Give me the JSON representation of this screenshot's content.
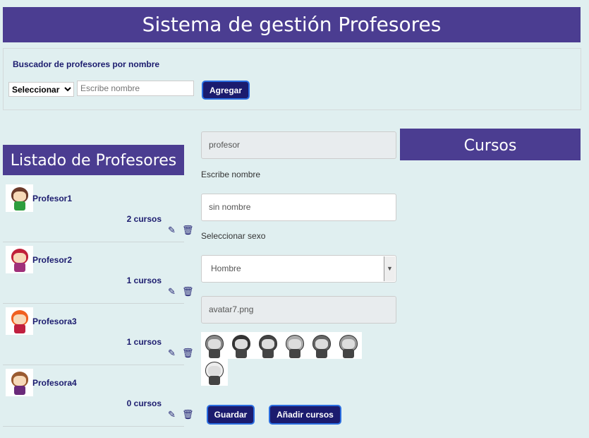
{
  "title": "Sistema de gestión Profesores",
  "search": {
    "label": "Buscador de profesores por nombre",
    "select": "Seleccionar",
    "placeholder": "Escribe nombre",
    "button": "Agregar"
  },
  "list": {
    "title": "Listado de Profesores",
    "items": [
      {
        "name": "Profesor1",
        "courses": "2 cursos",
        "hair": "#6b3a2a",
        "shirt": "#2e9e3e"
      },
      {
        "name": "Profesor2",
        "courses": "1 cursos",
        "hair": "#c0203a",
        "shirt": "#a0307a"
      },
      {
        "name": "Profesora3",
        "courses": "1 cursos",
        "hair": "#f06020",
        "shirt": "#c02040"
      },
      {
        "name": "Profesora4",
        "courses": "0 cursos",
        "hair": "#9a5a30",
        "shirt": "#6a2a7a"
      }
    ]
  },
  "form": {
    "role": "profesor",
    "name_label": "Escribe nombre",
    "name_value": "sin nombre",
    "sex_label": "Seleccionar sexo",
    "sex_value": "Hombre",
    "avatar": "avatar7.png",
    "save": "Guardar",
    "add_courses": "Añadir cursos"
  },
  "gallery": [
    "#888",
    "#333",
    "#444",
    "#aaa",
    "#666",
    "#999",
    "#eee"
  ],
  "cursos": {
    "title": "Cursos"
  }
}
